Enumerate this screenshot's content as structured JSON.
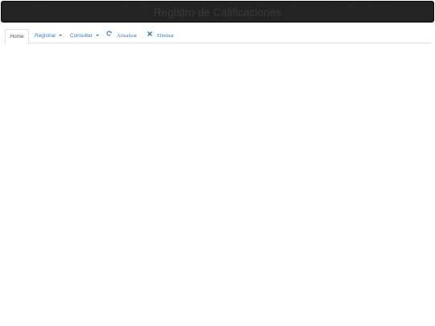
{
  "header": {
    "title": "Registro de Calificaciones"
  },
  "nav": {
    "tabs": [
      {
        "label": "Home",
        "active": true
      },
      {
        "label": "Registrar",
        "dropdown": true
      },
      {
        "label": "Consultar",
        "dropdown": true
      },
      {
        "label": "Actualizar",
        "icon": "refresh-icon"
      },
      {
        "label": "Eliminar",
        "icon": "remove-icon"
      }
    ]
  },
  "colors": {
    "header_bg": "#222222",
    "link": "#337ab7",
    "active_text": "#555555",
    "border": "#dddddd"
  }
}
